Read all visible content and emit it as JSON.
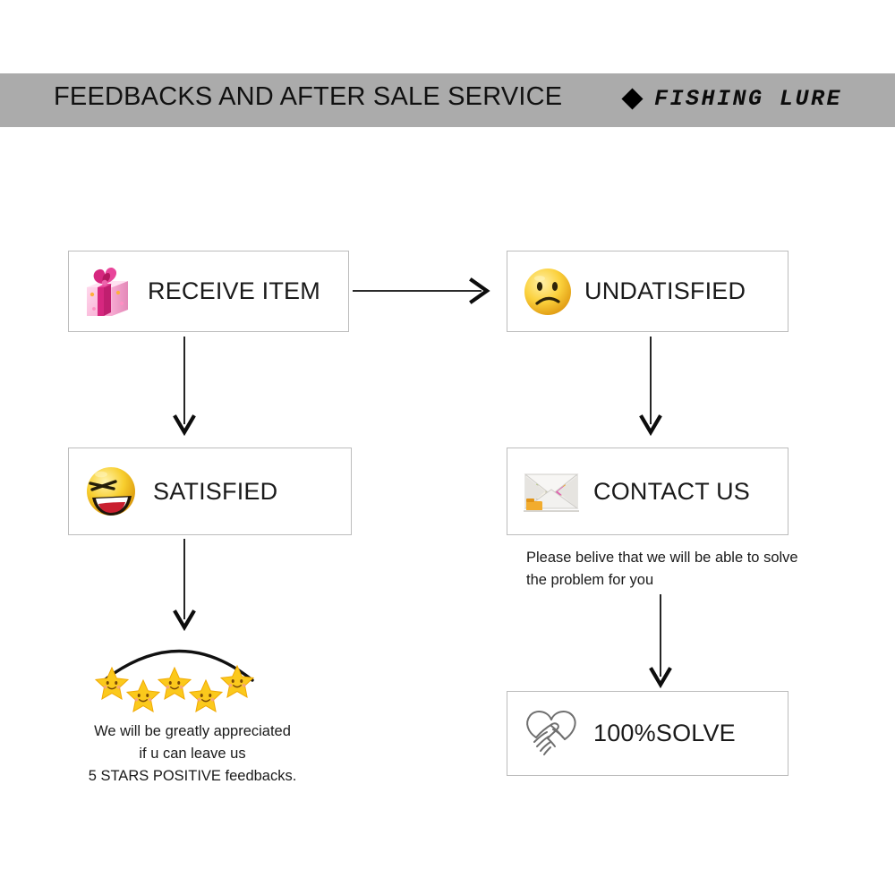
{
  "header": {
    "title": "FEEDBACKS AND AFTER SALE SERVICE",
    "brand_bullet_icon": "diamond-icon",
    "brand_text": "FISHING LURE",
    "background_color": "#ababab",
    "text_color": "#111111"
  },
  "flow": {
    "boxes": [
      {
        "id": "receive-item",
        "label": "RECEIVE ITEM",
        "icon": "gift-box-icon",
        "icon_colors": {
          "body": "#f9b9da",
          "ribbon": "#cc1f7b",
          "accent": "#ffb347"
        }
      },
      {
        "id": "undatisfied",
        "label": "UNDATISFIED",
        "icon": "sad-face-icon",
        "icon_colors": {
          "face": "#f7cf3f",
          "features": "#3a2c10"
        }
      },
      {
        "id": "satisfied",
        "label": "SATISFIED",
        "icon": "laughing-face-icon",
        "icon_colors": {
          "face": "#f5d033",
          "mouth": "#cf2030",
          "features": "#2b2310"
        }
      },
      {
        "id": "contact-us",
        "label": "CONTACT US",
        "icon": "envelope-icon",
        "icon_colors": {
          "paper": "#eceaea",
          "accent": "#e8a020"
        }
      },
      {
        "id": "solve",
        "label": "100%SOLVE",
        "icon": "handshake-heart-icon",
        "icon_colors": {
          "stroke": "#6b6b6b"
        }
      }
    ],
    "connectors": [
      {
        "id": "receive-to-undatisfied",
        "direction": "right"
      },
      {
        "id": "receive-to-satisfied",
        "direction": "down"
      },
      {
        "id": "undatisfied-to-contact",
        "direction": "down"
      },
      {
        "id": "satisfied-to-stars",
        "direction": "down"
      },
      {
        "id": "contact-to-solve",
        "direction": "down"
      }
    ]
  },
  "rating": {
    "star_icon": "smiling-star-icon",
    "star_count": 5,
    "star_color": "#f9c51a",
    "arc_color": "#111111"
  },
  "captions": {
    "left": [
      "We will be greatly appreciated",
      "if u can leave us",
      "5 STARS POSITIVE feedbacks."
    ],
    "right": [
      "Please belive that we will be able to solve",
      "the problem for you"
    ]
  }
}
